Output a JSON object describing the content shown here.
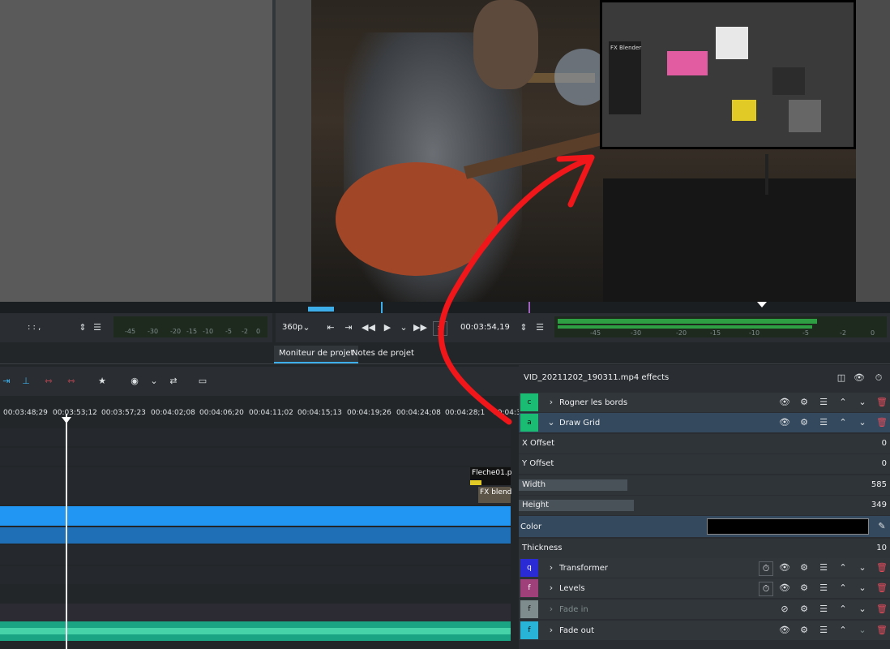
{
  "monitor": {
    "resolution": "360p",
    "timecode": "00:03:54,19",
    "clip_timecode": ":  :  ,",
    "meter_scale": [
      "-45",
      "-30",
      "-20",
      "-15",
      "-10",
      "-5",
      "-2",
      "0"
    ],
    "clip_meter_scale": [
      "-45",
      "-30",
      "-20",
      "-15",
      "-10",
      "-5",
      "-2",
      "0"
    ]
  },
  "tabs": {
    "project_monitor": "Moniteur de projet",
    "project_notes": "Notes de projet"
  },
  "timeline": {
    "ticks": [
      "00:03:48;29",
      "00:03:53;12",
      "00:03:57;23",
      "00:04:02;08",
      "00:04:06;20",
      "00:04:11;02",
      "00:04:15;13",
      "00:04:19;26",
      "00:04:24;08",
      "00:04:28;1",
      "00:04:3"
    ],
    "clip_fleche": "Fleche01.p",
    "clip_fx": "FX blend"
  },
  "video": {
    "pedal_label": "FX Blender"
  },
  "effects": {
    "title": "VID_20211202_190311.mp4 effects",
    "items": [
      {
        "letter": "c",
        "name": "Rogner les bords",
        "color": "#1abc73"
      },
      {
        "letter": "a",
        "name": "Draw Grid",
        "color": "#1abc73"
      },
      {
        "letter": "q",
        "name": "Transformer",
        "color": "#2b2bd6"
      },
      {
        "letter": "f",
        "name": "Levels",
        "color": "#a0407a"
      },
      {
        "letter": "f",
        "name": "Fade in",
        "color": "#7f8c8d"
      },
      {
        "letter": "f",
        "name": "Fade out",
        "color": "#27b4d6"
      }
    ],
    "params": [
      {
        "label": "X Offset",
        "value": "0"
      },
      {
        "label": "Y Offset",
        "value": "0"
      },
      {
        "label": "Width",
        "value": "585",
        "fill": 0.2
      },
      {
        "label": "Height",
        "value": "349",
        "fill": 0.22
      },
      {
        "label": "Color",
        "value": ""
      },
      {
        "label": "Thickness",
        "value": "10",
        "fill": 0
      }
    ]
  }
}
